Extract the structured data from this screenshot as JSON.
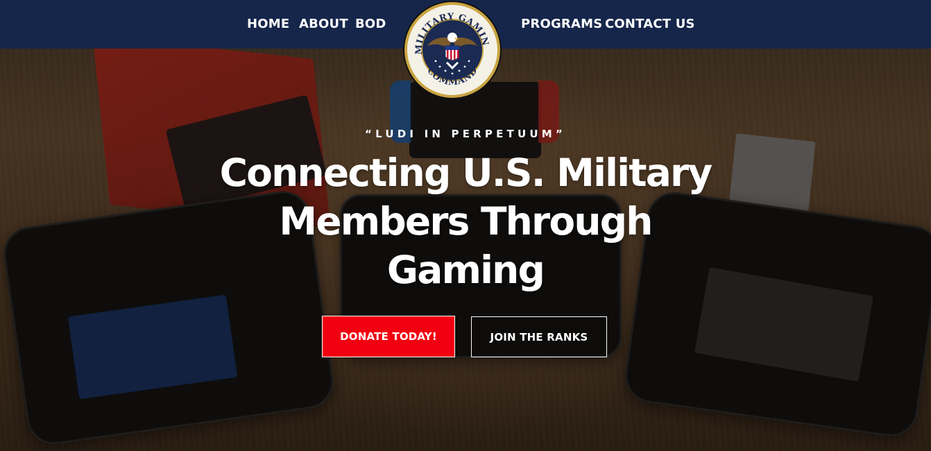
{
  "colors": {
    "nav_background": "#16264b",
    "donate_button": "#f20011",
    "text": "#ffffff"
  },
  "nav": {
    "items": [
      {
        "label": "HOME"
      },
      {
        "label": "ABOUT"
      },
      {
        "label": "BOD"
      },
      {
        "label": "PROGRAMS"
      },
      {
        "label": "CONTACT US"
      }
    ]
  },
  "logo": {
    "icon": "military-gaming-command-seal",
    "text_top": "MILITARY GAMING",
    "text_bottom": "COMMAND"
  },
  "hero": {
    "background_icon": "gaming-handhelds-photo",
    "motto": "“LUDI IN PERPETUUM”",
    "headline": "Connecting U.S. Military Members Through Gaming",
    "buttons": {
      "donate": "DONATE TODAY!",
      "join": "JOIN THE RANKS"
    }
  }
}
